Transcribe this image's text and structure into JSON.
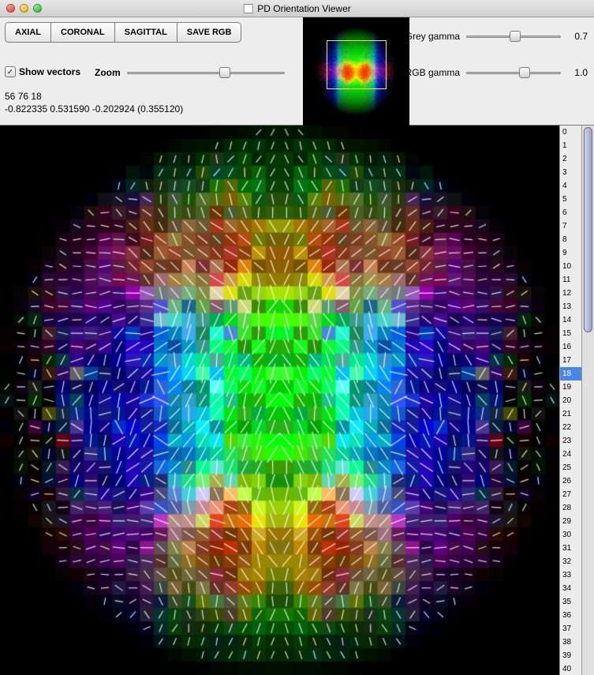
{
  "window": {
    "title": "PD Orientation Viewer"
  },
  "toolbar": {
    "buttons": {
      "axial": "AXIAL",
      "coronal": "CORONAL",
      "sagittal": "SAGITTAL",
      "save_rgb": "SAVE RGB"
    },
    "show_vectors": {
      "label": "Show vectors",
      "checked": true
    },
    "zoom": {
      "label": "Zoom",
      "value": 0.62
    },
    "grey_gamma": {
      "label": "Grey gamma",
      "value": "0.7",
      "slider": 0.52
    },
    "rgb_gamma": {
      "label": "RGB gamma",
      "value": "1.0",
      "slider": 0.62
    }
  },
  "status": {
    "voxel": "56 76 18",
    "vector": "-0.822335 0.531590 -0.202924 (0.355120)"
  },
  "ruler": {
    "min": 0,
    "max": 40,
    "selected": 18
  }
}
